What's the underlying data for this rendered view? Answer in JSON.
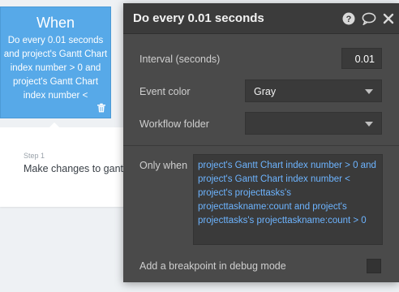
{
  "event_card": {
    "title": "When",
    "description": "Do every 0.01 seconds and project's Gantt Chart index number > 0 and project's Gantt Chart index number <"
  },
  "step": {
    "label": "Step 1",
    "title": "Make changes to gantt"
  },
  "panel": {
    "title": "Do every 0.01 seconds",
    "interval_label": "Interval (seconds)",
    "interval_value": "0.01",
    "event_color_label": "Event color",
    "event_color_value": "Gray",
    "workflow_folder_label": "Workflow folder",
    "workflow_folder_value": "",
    "only_when_label": "Only when",
    "only_when_expression": "project's Gantt Chart index number > 0 and project's Gantt Chart index number < project's projecttasks's projecttaskname:count and project's projecttasks's projecttaskname:count > 0",
    "breakpoint_label": "Add a breakpoint in debug mode"
  },
  "icons": {
    "help": "help-icon",
    "comment": "comment-icon",
    "close": "close-icon",
    "trash": "trash-icon",
    "dropdown": "chevron-down-icon"
  },
  "colors": {
    "event_card": "#57a9e8",
    "panel_bg": "#4a4a4a",
    "panel_header": "#3b3b3b",
    "expression_text": "#6db4ff"
  }
}
